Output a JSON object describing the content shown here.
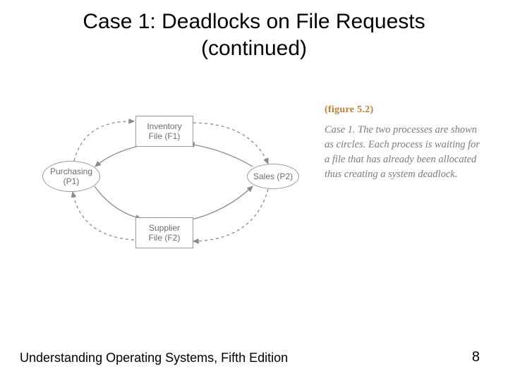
{
  "title": {
    "line1": "Case 1: Deadlocks on File Requests",
    "line2": "(continued)"
  },
  "diagram": {
    "nodes": {
      "p1": {
        "label": "Purchasing\n(P1)"
      },
      "p2": {
        "label": "Sales (P2)"
      },
      "f1": {
        "label": "Inventory\nFile (F1)"
      },
      "f2": {
        "label": "Supplier\nFile (F2)"
      }
    }
  },
  "figure": {
    "number": "(figure 5.2)",
    "text": "Case 1. The two processes are shown as circles. Each process is waiting for a file that has already been allocated thus creating a system deadlock."
  },
  "footer": {
    "book": "Understanding Operating Systems, Fifth Edition",
    "page": "8"
  }
}
